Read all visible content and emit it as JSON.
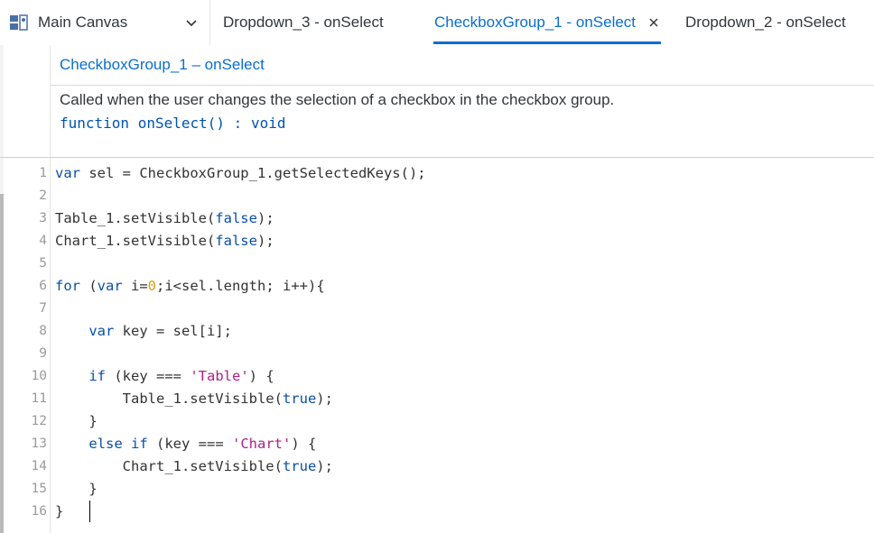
{
  "tabs": {
    "main_label": "Main Canvas",
    "dropdown3_label": "Dropdown_3 - onSelect",
    "checkbox_label": "CheckboxGroup_1 - onSelect",
    "dropdown2_label": "Dropdown_2 - onSelect"
  },
  "event": {
    "title": "CheckboxGroup_1 – onSelect",
    "description": "Called when the user changes the selection of a checkbox in the checkbox group.",
    "signature": {
      "kw_function": "function",
      "name": "onSelect",
      "rest": "() : ",
      "return_type": "void"
    }
  },
  "code": {
    "line_numbers": [
      "1",
      "2",
      "3",
      "4",
      "5",
      "6",
      "7",
      "8",
      "9",
      "10",
      "11",
      "12",
      "13",
      "14",
      "15",
      "16"
    ],
    "l1": {
      "kw": "var",
      "rest": " sel = CheckboxGroup_1.getSelectedKeys();"
    },
    "l3": {
      "a": "Table_1.setVisible(",
      "v": "false",
      "b": ");"
    },
    "l4": {
      "a": "Chart_1.setVisible(",
      "v": "false",
      "b": ");"
    },
    "l6": {
      "kw_for": "for",
      "p1": " (",
      "kw_var": "var",
      "p2": " i=",
      "zero": "0",
      "p3": ";i<sel.length; i++){"
    },
    "l8": {
      "indent": "    ",
      "kw": "var",
      "rest": " key = sel[i];"
    },
    "l10": {
      "indent": "    ",
      "kw": "if",
      "p1": " (key === ",
      "str": "'Table'",
      "p2": ") {"
    },
    "l11": {
      "indent": "        ",
      "a": "Table_1.setVisible(",
      "v": "true",
      "b": ");"
    },
    "l12": {
      "text": "    }"
    },
    "l13": {
      "indent": "    ",
      "kw_else": "else",
      "sp": " ",
      "kw_if": "if",
      "p1": " (key === ",
      "str": "'Chart'",
      "p2": ") {"
    },
    "l14": {
      "indent": "        ",
      "a": "Chart_1.setVisible(",
      "v": "true",
      "b": ");"
    },
    "l15": {
      "text": "    }"
    },
    "l16": {
      "text": "}"
    }
  },
  "colors": {
    "accent": "#0a6ed1",
    "keyword": "#0a4fa8",
    "string": "#b0208b",
    "number": "#d4a017"
  },
  "icons": {
    "main_tab": "canvas-icon",
    "main_dropdown": "chevron-down-icon",
    "close_tab": "close-icon"
  }
}
